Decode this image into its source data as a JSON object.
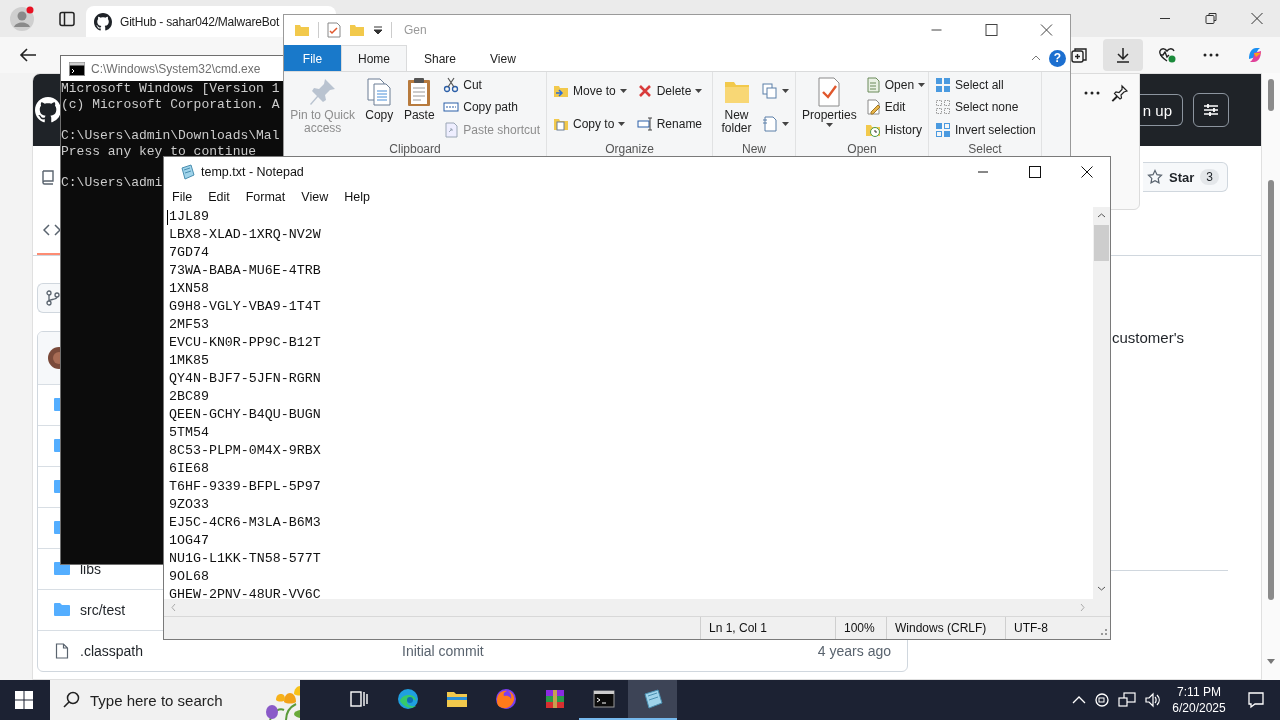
{
  "browser": {
    "tab_title": "GitHub - sahar042/MalwareBot",
    "page": {
      "signup_label": "n up",
      "star_label": "Star",
      "star_count": "3",
      "files": [
        {
          "kind": "folder"
        },
        {
          "kind": "folder"
        },
        {
          "kind": "folder"
        },
        {
          "kind": "folder"
        },
        {
          "kind": "folder",
          "name": "libs"
        },
        {
          "kind": "folder",
          "name": "src/test"
        },
        {
          "kind": "file",
          "name": ".classpath",
          "message": "Initial commit",
          "age": "4 years ago"
        }
      ],
      "about_fragment": "customer's"
    }
  },
  "cmd": {
    "title": "C:\\Windows\\System32\\cmd.exe",
    "blocks": [
      [
        "Microsoft Windows [Version 1",
        "(c) Microsoft Corporation. A"
      ],
      [
        "C:\\Users\\admin\\Downloads\\Mal",
        "Press any key to continue"
      ],
      [
        "C:\\Users\\admi"
      ]
    ]
  },
  "explorer": {
    "title": "Gen",
    "help_label": "?",
    "tabs": [
      {
        "label": "File",
        "kind": "backstage",
        "selected": false
      },
      {
        "label": "Home",
        "kind": "tab",
        "selected": true
      },
      {
        "label": "Share",
        "kind": "tab",
        "selected": false
      },
      {
        "label": "View",
        "kind": "tab",
        "selected": false
      }
    ],
    "groups": [
      {
        "label": "Clipboard",
        "commands": [
          {
            "label": "Pin to Quick access",
            "kind": "large",
            "disabled": true,
            "menu": false
          },
          {
            "label": "Copy",
            "kind": "large",
            "disabled": false,
            "menu": false
          },
          {
            "label": "Paste",
            "kind": "large",
            "disabled": false,
            "menu": false
          },
          {
            "label": "Cut",
            "kind": "small",
            "disabled": false,
            "menu": false
          },
          {
            "label": "Copy path",
            "kind": "small",
            "disabled": false,
            "menu": false
          },
          {
            "label": "Paste shortcut",
            "kind": "small",
            "disabled": true,
            "menu": false
          }
        ]
      },
      {
        "label": "Organize",
        "commands": [
          {
            "label": "Move to",
            "kind": "small",
            "disabled": false,
            "menu": true
          },
          {
            "label": "Copy to",
            "kind": "small",
            "disabled": false,
            "menu": true
          },
          {
            "label": "Delete",
            "kind": "small",
            "disabled": false,
            "menu": true
          },
          {
            "label": "Rename",
            "kind": "small",
            "disabled": false,
            "menu": false
          }
        ]
      },
      {
        "label": "New",
        "commands": [
          {
            "label": "New folder",
            "kind": "large",
            "disabled": false,
            "menu": false
          },
          {
            "kind": "icon",
            "disabled": false,
            "menu": true
          },
          {
            "kind": "icon",
            "disabled": false,
            "menu": true
          }
        ]
      },
      {
        "label": "Open",
        "commands": [
          {
            "label": "Properties",
            "kind": "large",
            "disabled": false,
            "menu": true
          },
          {
            "label": "Open",
            "kind": "small",
            "disabled": false,
            "menu": true
          },
          {
            "label": "Edit",
            "kind": "small",
            "disabled": false,
            "menu": false
          },
          {
            "label": "History",
            "kind": "small",
            "disabled": false,
            "menu": false
          }
        ]
      },
      {
        "label": "Select",
        "commands": [
          {
            "label": "Select all",
            "kind": "small",
            "disabled": false,
            "menu": false
          },
          {
            "label": "Select none",
            "kind": "small",
            "disabled": false,
            "menu": false
          },
          {
            "label": "Invert selection",
            "kind": "small",
            "disabled": false,
            "menu": false
          }
        ]
      }
    ]
  },
  "notepad": {
    "title": "temp.txt - Notepad",
    "menu": [
      "File",
      "Edit",
      "Format",
      "View",
      "Help"
    ],
    "lines": [
      "1JL89",
      "LBX8-XLAD-1XRQ-NV2W",
      "7GD74",
      "73WA-BABA-MU6E-4TRB",
      "1XN58",
      "G9H8-VGLY-VBA9-1T4T",
      "2MF53",
      "EVCU-KN0R-PP9C-B12T",
      "1MK85",
      "QY4N-BJF7-5JFN-RGRN",
      "2BC89",
      "QEEN-GCHY-B4QU-BUGN",
      "5TM54",
      "8C53-PLPM-0M4X-9RBX",
      "6IE68",
      "T6HF-9339-BFPL-5P97",
      "9ZO33",
      "EJ5C-4CR6-M3LA-B6M3",
      "1OG47",
      "NU1G-L1KK-TN58-577T",
      "9OL68",
      "GHEW-2PNV-48UR-VV6C"
    ],
    "status": [
      "Ln 1, Col 1",
      "100%",
      "Windows (CRLF)",
      "UTF-8"
    ]
  },
  "taskbar": {
    "search_placeholder": "Type here to search",
    "time": "7:11 PM",
    "date": "6/20/2025",
    "apps": [
      {
        "running": false,
        "selected": false
      },
      {
        "running": false,
        "selected": false
      },
      {
        "running": false,
        "selected": false
      },
      {
        "running": false,
        "selected": false
      },
      {
        "running": true,
        "selected": false
      },
      {
        "running": true,
        "selected": true
      }
    ]
  }
}
